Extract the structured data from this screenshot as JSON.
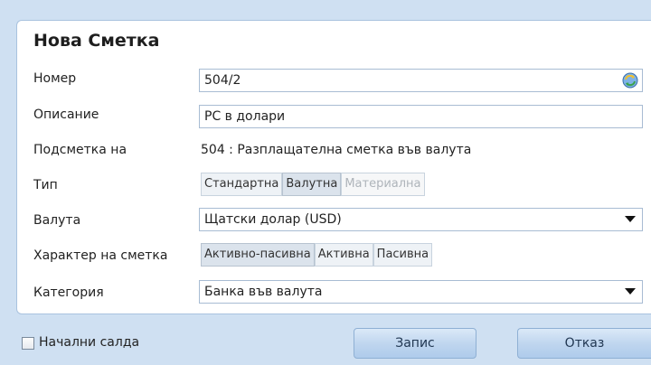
{
  "dialog": {
    "title": "Нова Сметка"
  },
  "form": {
    "number": {
      "label": "Номер",
      "value": "504/2"
    },
    "description": {
      "label": "Описание",
      "value": "PC в долари"
    },
    "parent": {
      "label": "Подсметка на",
      "value": "504 : Разплащателна сметка във валута"
    },
    "type": {
      "label": "Тип",
      "options": [
        "Стандартна",
        "Валутна",
        "Материална"
      ],
      "selected": "Валутна",
      "disabled": [
        "Материална"
      ]
    },
    "currency": {
      "label": "Валута",
      "value": "Щатски долар (USD)"
    },
    "character": {
      "label": "Характер на сметка",
      "options": [
        "Активно-пасивна",
        "Активна",
        "Пасивна"
      ],
      "selected": "Активно-пасивна"
    },
    "category": {
      "label": "Категория",
      "value": "Банка във валута"
    }
  },
  "footer": {
    "opening_balances_label": "Начални салда",
    "opening_balances_checked": false,
    "save_label": "Запис",
    "cancel_label": "Отказ"
  },
  "icons": {
    "number_action": "refresh-icon",
    "dropdown": "chevron-down-icon"
  }
}
